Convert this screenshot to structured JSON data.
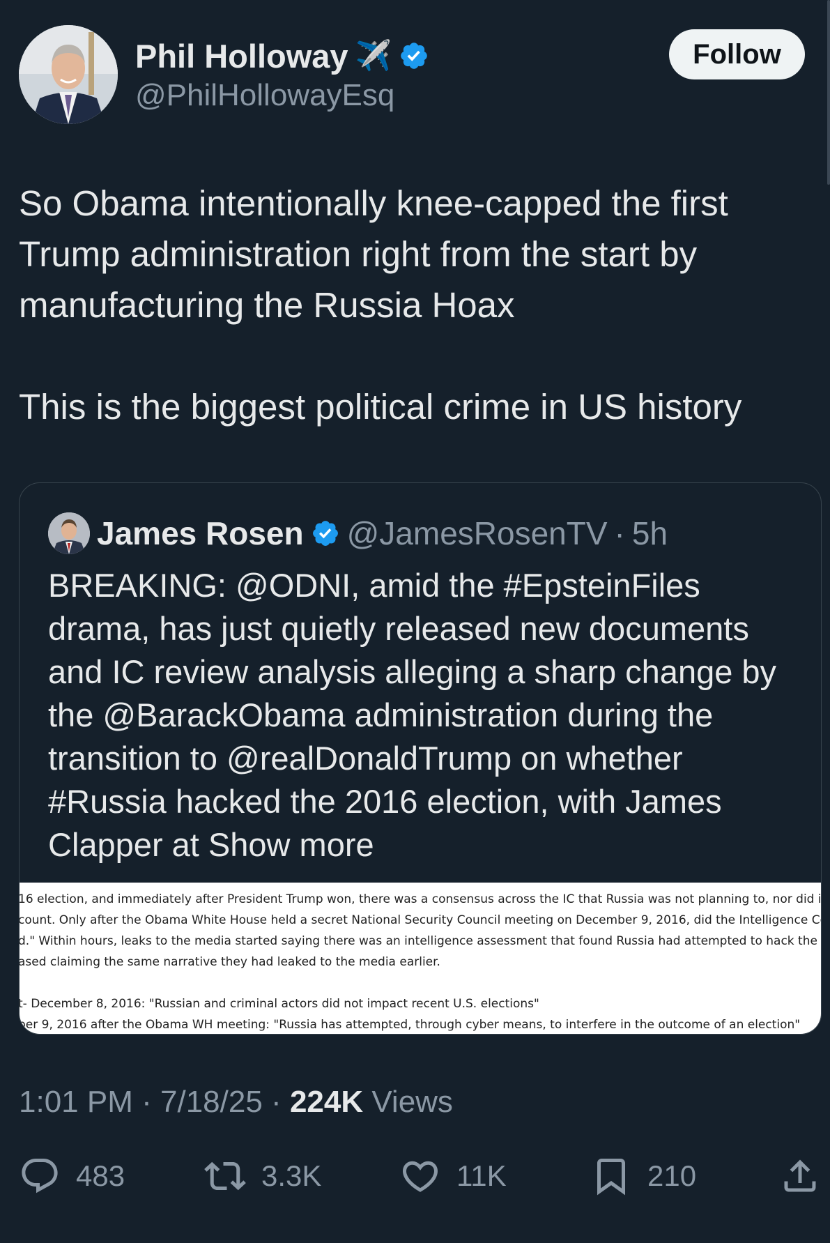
{
  "author": {
    "name": "Phil Holloway",
    "handle": "@PhilHollowayEsq",
    "badge_emoji": "✈️",
    "verified": true,
    "verified_color": "#1d9bf0"
  },
  "follow_label": "Follow",
  "tweet": {
    "paragraph1": "So Obama intentionally knee-capped the first Trump administration right from the start by manufacturing the Russia Hoax",
    "paragraph2": "This is the biggest political crime in US history"
  },
  "quote": {
    "name": "James Rosen",
    "handle": "@JamesRosenTV",
    "separator": "·",
    "time": "5h",
    "text": "BREAKING: @ODNI, amid the #EpsteinFiles drama, has just quietly released new documents and IC review analysis alleging a sharp change by the @BarackObama administration during the transition to @realDonaldTrump on whether #Russia hacked the 2016 election, with James Clapper at",
    "show_more": "Show more",
    "image_lines": [
      "16 election, and immediately after President Trump won, there was a consensus across the IC that Russia was not planning to, nor did it have th",
      " count. Only after the Obama White House held a secret National Security Council meeting on December 9, 2016, did the Intelligence Commu",
      "d.\" Within hours, leaks to the media started saying there was an intelligence assessment that found Russia had attempted to hack the election.",
      "ased claiming the same narrative they had leaked to the media earlier.",
      "t- December 8, 2016: \"Russian and criminal actors did not impact recent U.S. elections\"",
      "ber 9, 2016 after the Obama WH meeting: \"Russia has attempted, through cyber means, to interfere in the outcome of an election\""
    ]
  },
  "meta": {
    "time": "1:01 PM",
    "date": "7/18/25",
    "separator": "·",
    "views_count": "224K",
    "views_label": "Views"
  },
  "actions": {
    "replies": "483",
    "reposts": "3.3K",
    "likes": "11K",
    "bookmarks": "210"
  },
  "icons": [
    "reply-icon",
    "repost-icon",
    "like-icon",
    "bookmark-icon",
    "share-icon",
    "verified-badge-icon"
  ],
  "colors": {
    "background": "#15202b",
    "text_primary": "#e7e9ea",
    "text_secondary": "#8b98a5",
    "border": "#38444d",
    "verified": "#1d9bf0"
  }
}
